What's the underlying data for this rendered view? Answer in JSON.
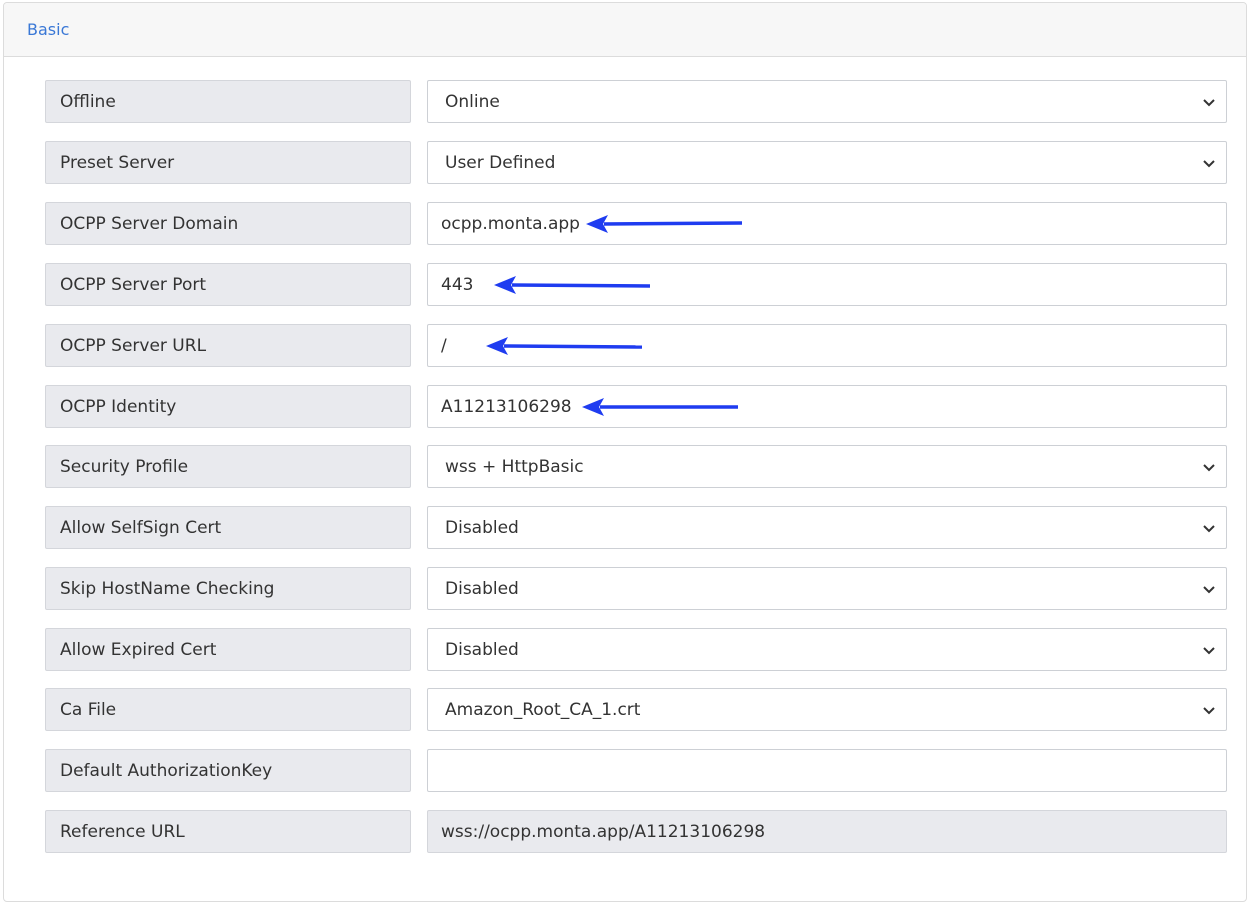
{
  "header": {
    "title": "Basic"
  },
  "annotation_color": "#1f3cf0",
  "rows": [
    {
      "label": "Offline",
      "type": "select",
      "value": "Online"
    },
    {
      "label": "Preset Server",
      "type": "select",
      "value": "User Defined"
    },
    {
      "label": "OCPP Server Domain",
      "type": "input",
      "value": "ocpp.monta.app",
      "arrow": true
    },
    {
      "label": "OCPP Server Port",
      "type": "input",
      "value": "443",
      "arrow": true
    },
    {
      "label": "OCPP Server URL",
      "type": "input",
      "value": "/",
      "arrow": true
    },
    {
      "label": "OCPP Identity",
      "type": "input",
      "value": "A11213106298",
      "arrow": true
    },
    {
      "label": "Security Profile",
      "type": "select",
      "value": "wss + HttpBasic"
    },
    {
      "label": "Allow SelfSign Cert",
      "type": "select",
      "value": "Disabled"
    },
    {
      "label": "Skip HostName Checking",
      "type": "select",
      "value": "Disabled"
    },
    {
      "label": "Allow Expired Cert",
      "type": "select",
      "value": "Disabled"
    },
    {
      "label": "Ca File",
      "type": "select",
      "value": "Amazon_Root_CA_1.crt"
    },
    {
      "label": "Default AuthorizationKey",
      "type": "input",
      "value": ""
    },
    {
      "label": "Reference URL",
      "type": "readonly",
      "value": "wss://ocpp.monta.app/A11213106298"
    }
  ]
}
